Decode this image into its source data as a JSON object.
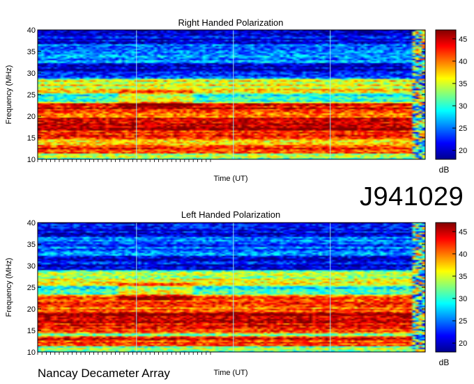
{
  "observation_id": "J941029",
  "instrument": "Nancay Decameter Array",
  "colorscale": {
    "name": "jet",
    "unit": "dB",
    "range": [
      18,
      47
    ],
    "ticks": [
      20,
      25,
      30,
      35,
      40,
      45
    ]
  },
  "chart_data": [
    {
      "type": "heatmap",
      "title": "Right Handed Polarization",
      "xlabel": "Time (UT)",
      "ylabel": "Frequency (MHz)",
      "ylim": [
        10,
        40
      ],
      "yticks": [
        10,
        15,
        20,
        25,
        30,
        35,
        40
      ],
      "colorbar_label": "dB",
      "colorbar_ticks": [
        20,
        25,
        30,
        35,
        40,
        45
      ],
      "bands": [
        {
          "freq_range": [
            10,
            11
          ],
          "db": 33
        },
        {
          "freq_range": [
            12,
            13
          ],
          "db": 42
        },
        {
          "freq_range": [
            13.5,
            14.5
          ],
          "db": 35
        },
        {
          "freq_range": [
            15,
            17
          ],
          "db": 43
        },
        {
          "freq_range": [
            17,
            19
          ],
          "db": 46
        },
        {
          "freq_range": [
            19,
            21
          ],
          "db": 40
        },
        {
          "freq_range": [
            21.5,
            22.5
          ],
          "db": 44
        },
        {
          "freq_range": [
            23,
            25
          ],
          "db": 30
        },
        {
          "freq_range": [
            26,
            28
          ],
          "db": 36
        },
        {
          "freq_range": [
            33,
            34
          ],
          "db": 26
        },
        {
          "freq_range": [
            35,
            36
          ],
          "db": 25
        }
      ]
    },
    {
      "type": "heatmap",
      "title": "Left Handed Polarization",
      "xlabel": "Time (UT)",
      "ylabel": "Frequency (MHz)",
      "ylim": [
        10,
        40
      ],
      "yticks": [
        10,
        15,
        20,
        25,
        30,
        35,
        40
      ],
      "colorbar_label": "dB",
      "colorbar_ticks": [
        20,
        25,
        30,
        35,
        40,
        45
      ],
      "bands": [
        {
          "freq_range": [
            10,
            11
          ],
          "db": 32
        },
        {
          "freq_range": [
            12,
            13
          ],
          "db": 42
        },
        {
          "freq_range": [
            13.5,
            14.5
          ],
          "db": 34
        },
        {
          "freq_range": [
            15,
            17
          ],
          "db": 43
        },
        {
          "freq_range": [
            17,
            19
          ],
          "db": 45
        },
        {
          "freq_range": [
            19,
            21
          ],
          "db": 40
        },
        {
          "freq_range": [
            21.5,
            22.5
          ],
          "db": 43
        },
        {
          "freq_range": [
            23,
            25
          ],
          "db": 29
        },
        {
          "freq_range": [
            26,
            28
          ],
          "db": 35
        },
        {
          "freq_range": [
            33,
            34
          ],
          "db": 25
        },
        {
          "freq_range": [
            35,
            36
          ],
          "db": 24
        }
      ]
    }
  ]
}
